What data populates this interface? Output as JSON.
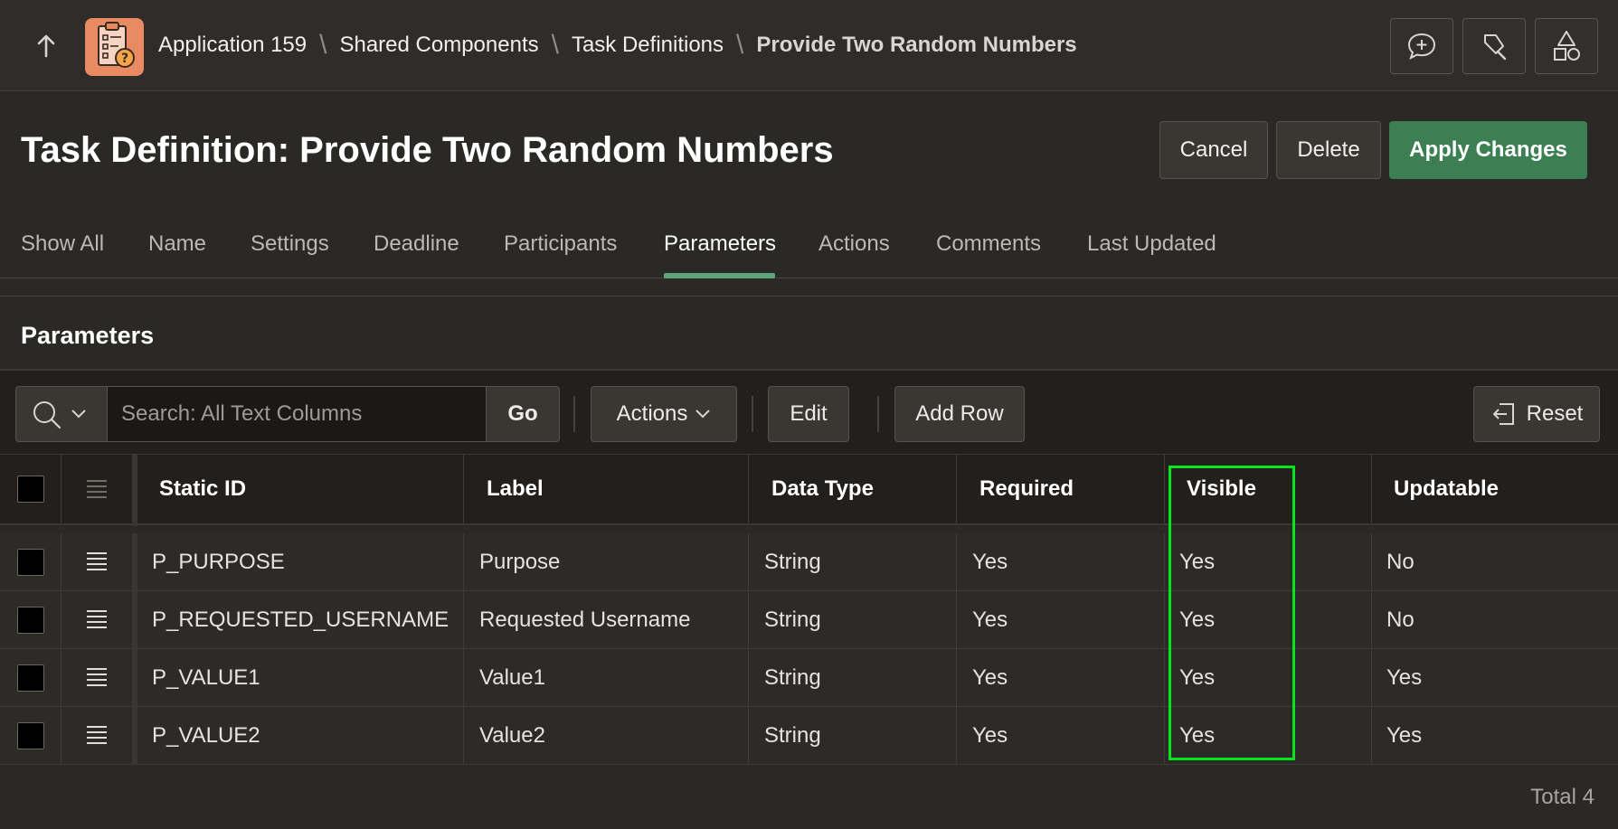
{
  "topbar": {
    "breadcrumb": [
      "Application 159",
      "Shared Components",
      "Task Definitions"
    ],
    "current": "Provide Two Random Numbers",
    "icons": [
      "up-arrow-icon",
      "app-icon",
      "feedback-icon",
      "flashlight-icon",
      "shared-components-icon"
    ]
  },
  "header": {
    "title": "Task Definition: Provide Two Random Numbers",
    "cancel": "Cancel",
    "delete": "Delete",
    "apply": "Apply Changes"
  },
  "tabs": [
    "Show All",
    "Name",
    "Settings",
    "Deadline",
    "Participants",
    "Parameters",
    "Actions",
    "Comments",
    "Last Updated"
  ],
  "active_tab": "Parameters",
  "region": {
    "title": "Parameters",
    "search_placeholder": "Search: All Text Columns",
    "go": "Go",
    "actions": "Actions",
    "edit": "Edit",
    "add_row": "Add Row",
    "reset": "Reset"
  },
  "grid": {
    "columns": [
      "Static ID",
      "Label",
      "Data Type",
      "Required",
      "Visible",
      "Updatable"
    ],
    "rows": [
      [
        "P_PURPOSE",
        "Purpose",
        "String",
        "Yes",
        "Yes",
        "No"
      ],
      [
        "P_REQUESTED_USERNAME",
        "Requested Username",
        "String",
        "Yes",
        "Yes",
        "No"
      ],
      [
        "P_VALUE1",
        "Value1",
        "String",
        "Yes",
        "Yes",
        "Yes"
      ],
      [
        "P_VALUE2",
        "Value2",
        "String",
        "Yes",
        "Yes",
        "Yes"
      ]
    ],
    "total": "Total 4"
  },
  "colors": {
    "primary": "#3b7f53",
    "highlight": "#00e81d",
    "background": "#2b2926"
  }
}
